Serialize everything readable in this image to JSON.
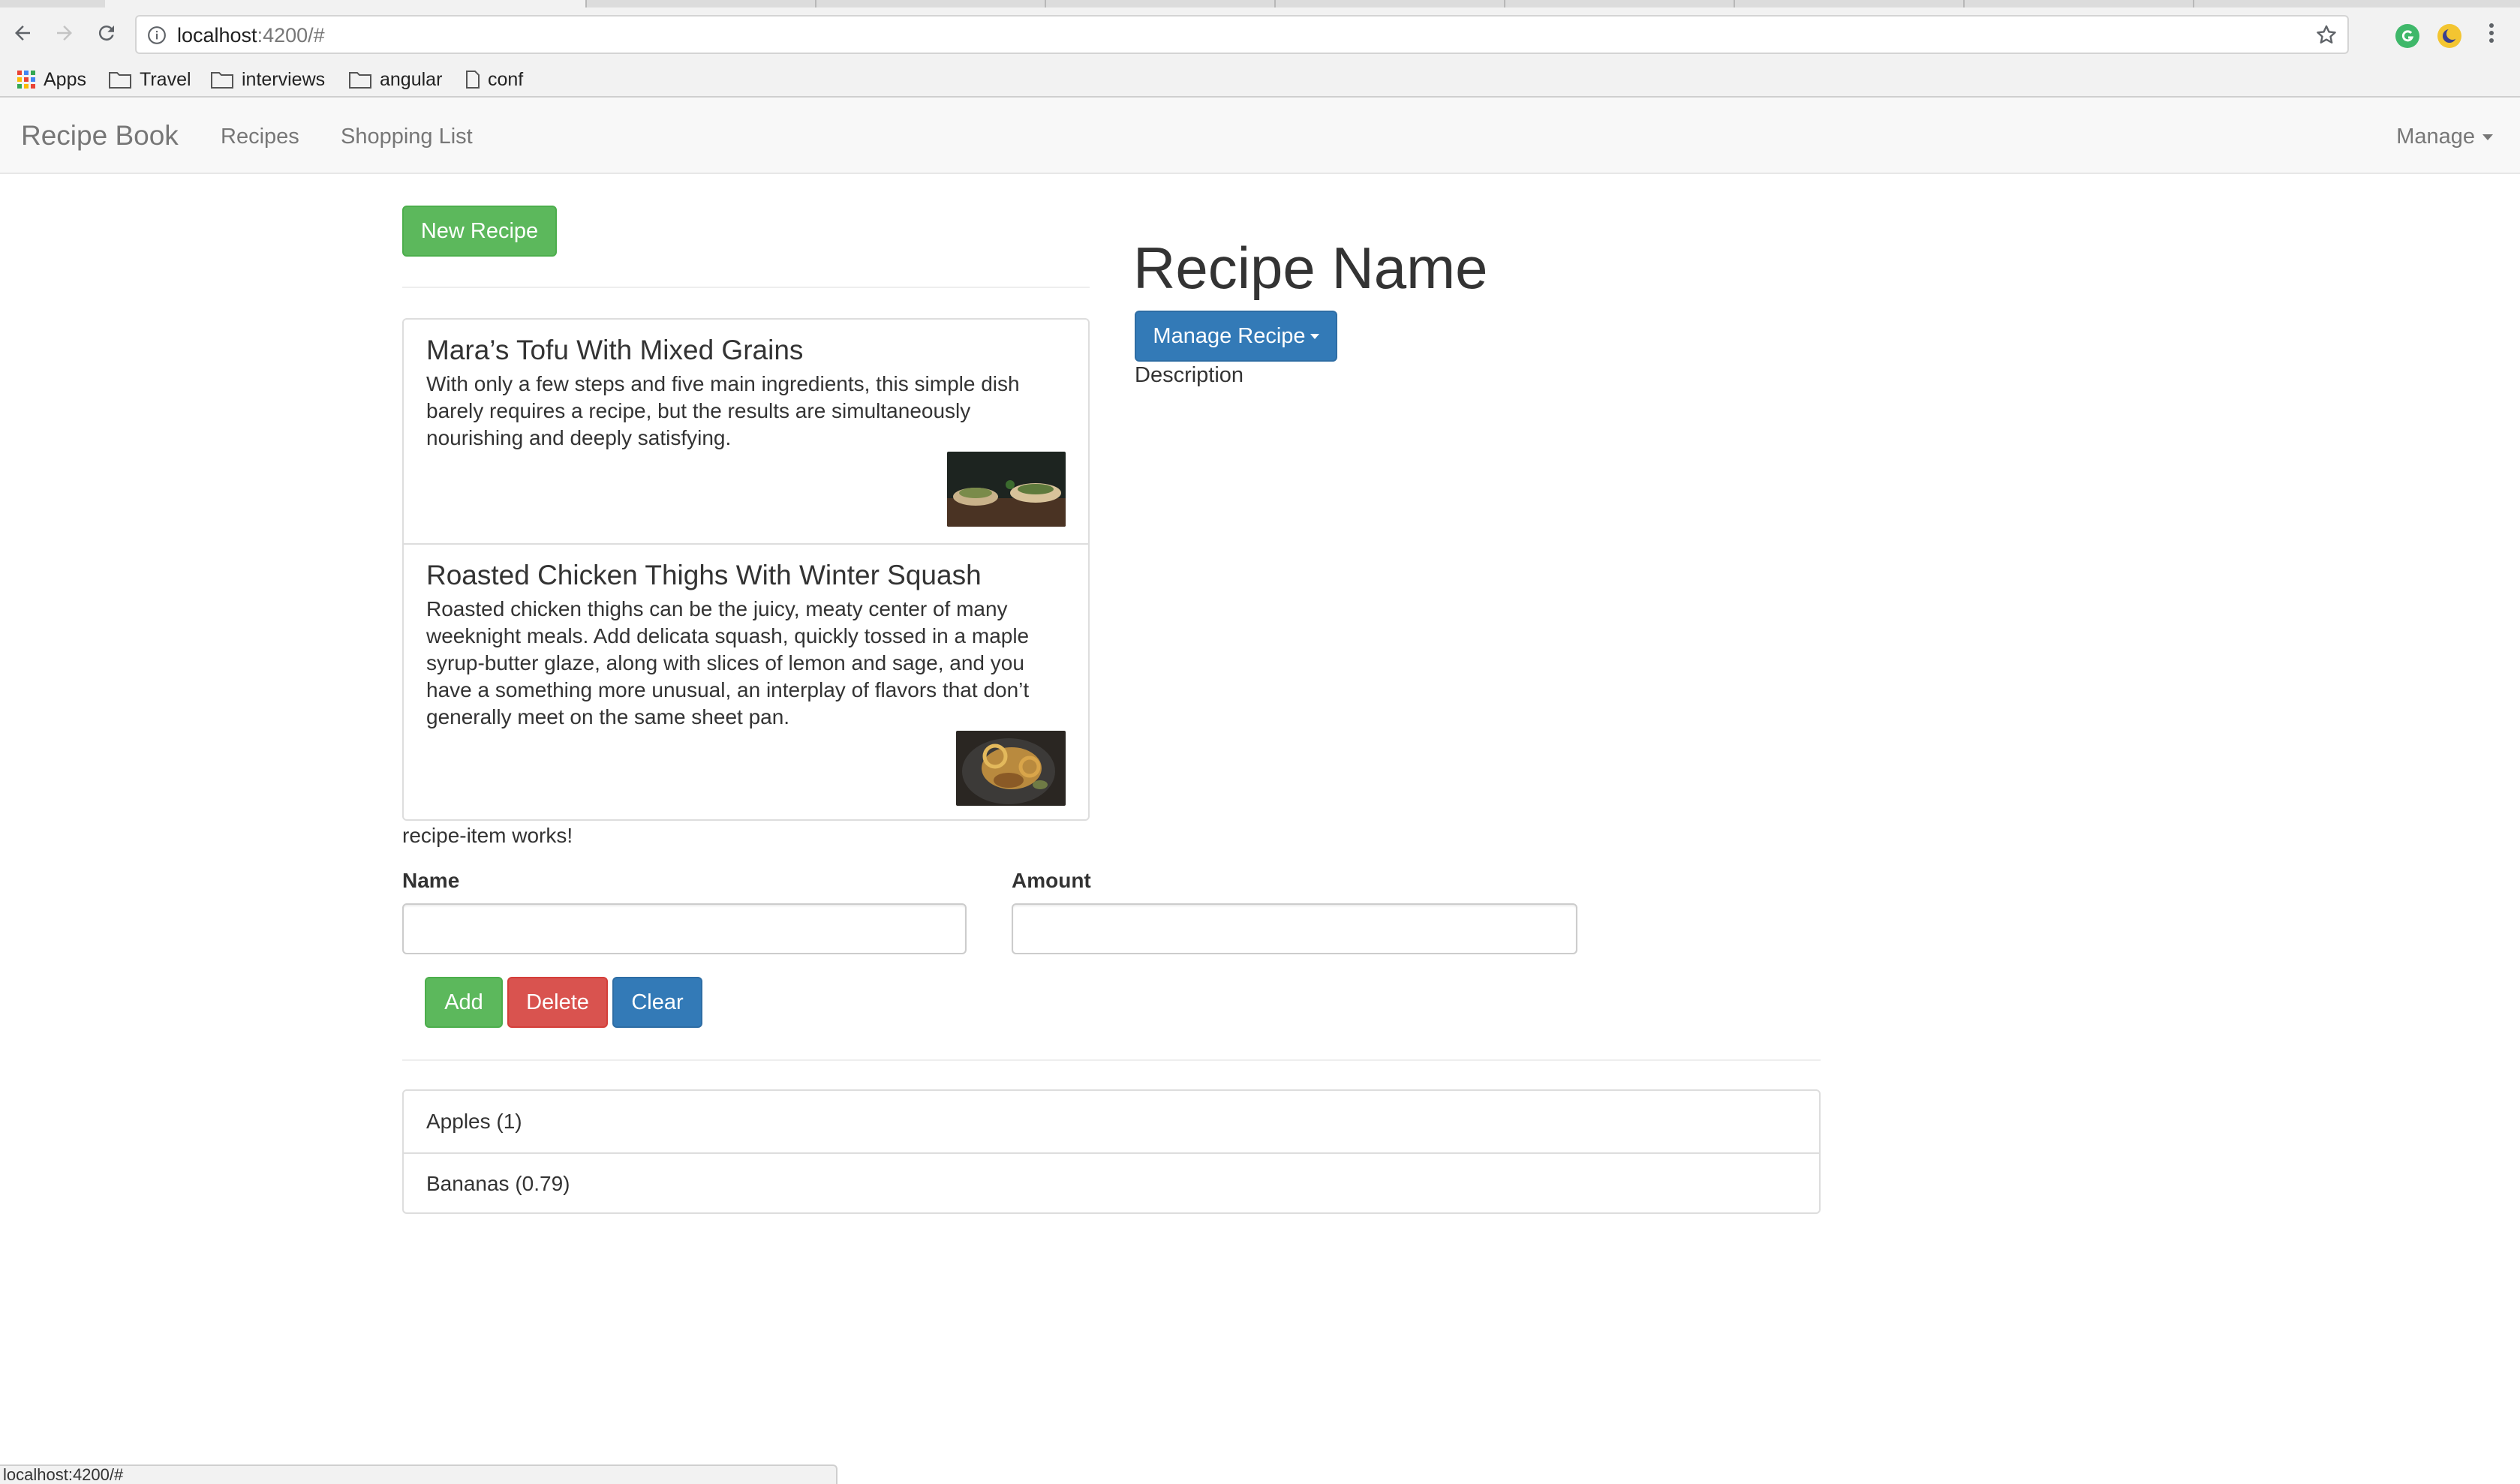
{
  "browser": {
    "url_host": "localhost",
    "url_rest": ":4200/#",
    "bookmarks": [
      {
        "label": "Apps",
        "icon": "apps-grid-icon"
      },
      {
        "label": "Travel",
        "icon": "folder-icon"
      },
      {
        "label": "interviews",
        "icon": "folder-icon"
      },
      {
        "label": "angular",
        "icon": "folder-icon"
      },
      {
        "label": "conf",
        "icon": "page-icon"
      }
    ],
    "status_url": "localhost:4200/#"
  },
  "navbar": {
    "brand": "Recipe Book",
    "links": [
      "Recipes",
      "Shopping List"
    ],
    "manage": "Manage"
  },
  "recipes": {
    "new_button": "New Recipe",
    "items": [
      {
        "title": "Mara’s Tofu With Mixed Grains",
        "description": "With only a few steps and five main ingredients, this simple dish barely requires a recipe, but the results are simultaneously nourishing and deeply satisfying."
      },
      {
        "title": "Roasted Chicken Thighs With Winter Squash",
        "description": "Roasted chicken thighs can be the juicy, meaty center of many weeknight meals. Add delicata squash, quickly tossed in a maple syrup-butter glaze, along with slices of lemon and sage, and you have a something more unusual, an interplay of flavors that don’t generally meet on the same sheet pan."
      }
    ],
    "item_works": "recipe-item works!"
  },
  "detail": {
    "name": "Recipe Name",
    "manage_button": "Manage Recipe",
    "description": "Description"
  },
  "shopping_edit": {
    "name_label": "Name",
    "amount_label": "Amount",
    "name_value": "",
    "amount_value": "",
    "add": "Add",
    "delete": "Delete",
    "clear": "Clear"
  },
  "shopping_list": [
    "Apples (1)",
    "Bananas (0.79)"
  ],
  "colors": {
    "success": "#5cb85c",
    "danger": "#d9534f",
    "primary": "#337ab7"
  }
}
